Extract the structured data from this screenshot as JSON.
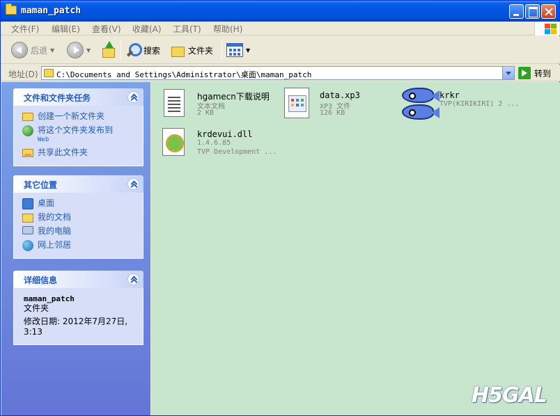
{
  "window": {
    "title": "maman_patch"
  },
  "menu": [
    "文件(F)",
    "编辑(E)",
    "查看(V)",
    "收藏(A)",
    "工具(T)",
    "帮助(H)"
  ],
  "toolbar": {
    "back": "后退",
    "search": "搜索",
    "folders": "文件夹"
  },
  "address": {
    "label": "地址(D)",
    "path": "C:\\Documents and Settings\\Administrator\\桌面\\maman_patch",
    "go": "转到"
  },
  "tasks": {
    "title": "文件和文件夹任务",
    "items": [
      {
        "label": "创建一个新文件夹"
      },
      {
        "label": "将这个文件夹发布到",
        "sub": "Web"
      },
      {
        "label": "共享此文件夹"
      }
    ]
  },
  "places": {
    "title": "其它位置",
    "items": [
      "桌面",
      "我的文档",
      "我的电脑",
      "网上邻居"
    ]
  },
  "details": {
    "title": "详细信息",
    "name": "maman_patch",
    "type": "文件夹",
    "modified": "修改日期: 2012年7月27日,",
    "time": "3:13"
  },
  "files": [
    {
      "name": "hgamecn下载说明",
      "meta1": "文本文档",
      "meta2": "2 KB",
      "icon": "text-document-icon"
    },
    {
      "name": "data.xp3",
      "meta1": "XP3 文件",
      "meta2": "126 KB",
      "icon": "xp3-file-icon"
    },
    {
      "name": "krkr",
      "meta1": "TVP(KIRIKIRI) 2 ...",
      "meta2": "",
      "icon": "fish-icon"
    },
    {
      "name": "krdevui.dll",
      "meta1": "1.4.6.85",
      "meta2": "TVP Development ...",
      "icon": "dll-gear-icon"
    }
  ],
  "watermark": "H5GAL"
}
